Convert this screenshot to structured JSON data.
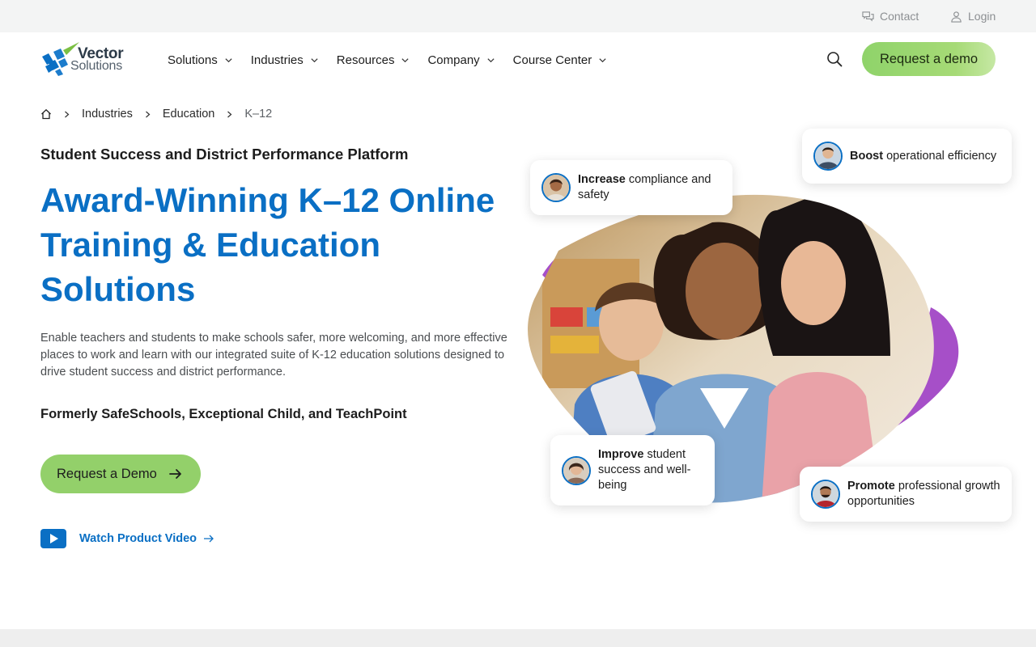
{
  "utility": {
    "contact": "Contact",
    "login": "Login"
  },
  "logo": {
    "line1": "Vector",
    "line2": "Solutions"
  },
  "nav": {
    "items": [
      "Solutions",
      "Industries",
      "Resources",
      "Company",
      "Course Center"
    ]
  },
  "header": {
    "demo_button": "Request a demo"
  },
  "breadcrumb": {
    "items": [
      "Industries",
      "Education"
    ],
    "current": "K–12"
  },
  "hero": {
    "eyebrow": "Student Success and District Performance Platform",
    "headline": "Award-Winning K–12 Online Training & Education Solutions",
    "description": "Enable teachers and students to make schools safer, more welcoming, and more effective places to work and learn with our integrated suite of K-12 education solutions designed to drive student success and district performance.",
    "formerly": "Formerly SafeSchools, Exceptional Child, and TeachPoint",
    "demo_button": "Request a Demo",
    "video_link": "Watch Product Video"
  },
  "callouts": [
    {
      "bold": "Increase",
      "rest": " compliance and safety"
    },
    {
      "bold": "Boost",
      "rest": " operational efficiency"
    },
    {
      "bold": "Improve",
      "rest": " student success and well-being"
    },
    {
      "bold": "Promote",
      "rest": " professional growth opportunities"
    }
  ],
  "colors": {
    "brand_blue": "#0a6fc4",
    "accent_green": "#93d06a",
    "accent_purple": "#a64fc8"
  }
}
